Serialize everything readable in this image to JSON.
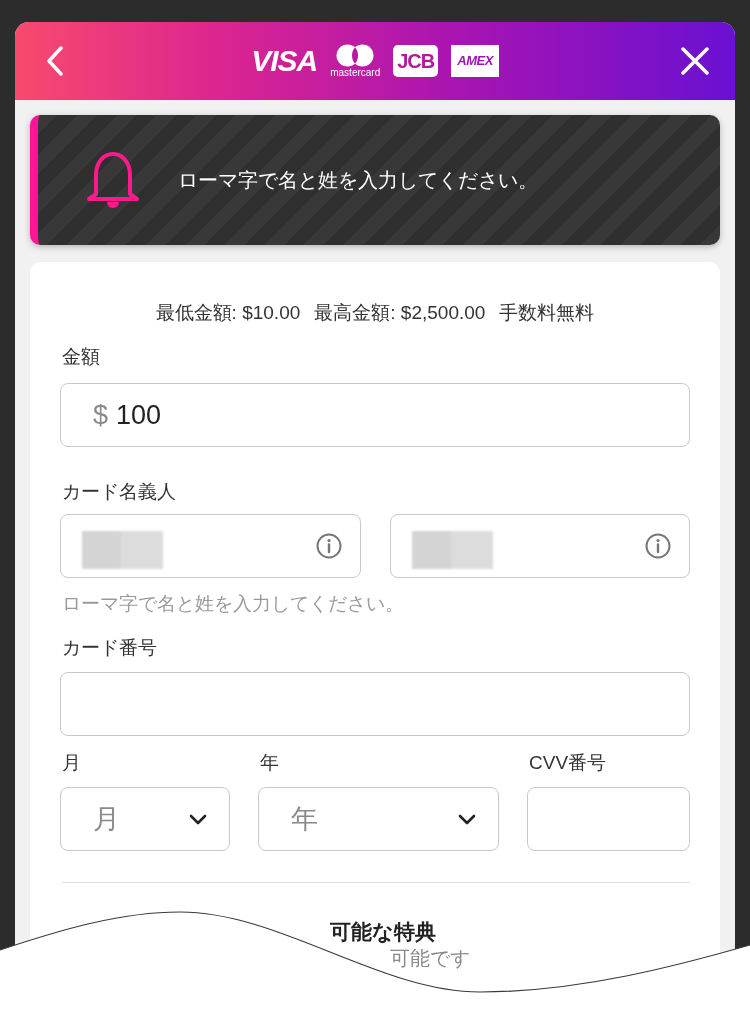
{
  "header": {
    "logos": [
      {
        "kind": "visa",
        "text": "VISA"
      },
      {
        "kind": "mastercard",
        "text": "mastercard"
      },
      {
        "kind": "jcb",
        "text": "JCB"
      },
      {
        "kind": "amex",
        "text": "AMEX"
      }
    ]
  },
  "notice": {
    "message": "ローマ字で名と姓を入力してください。"
  },
  "limits": [
    "最低金額: $10.00",
    "最高金額: $2,500.00",
    "手数料無料"
  ],
  "amount": {
    "label": "金額",
    "currency": "$",
    "value": "100"
  },
  "cardholder": {
    "label": "カード名義人",
    "fields": [
      {
        "blurred": true
      },
      {
        "blurred": true
      }
    ],
    "hint": "ローマ字で名と姓を入力してください。"
  },
  "card_number": {
    "label": "カード番号"
  },
  "expiry": [
    {
      "kind": "select",
      "label": "月",
      "placeholder": "月"
    },
    {
      "kind": "select",
      "label": "年",
      "placeholder": "年"
    },
    {
      "kind": "input",
      "label": "CVV番号"
    }
  ],
  "bonus": {
    "title": "可能な特典",
    "subtitle": "可能です"
  }
}
